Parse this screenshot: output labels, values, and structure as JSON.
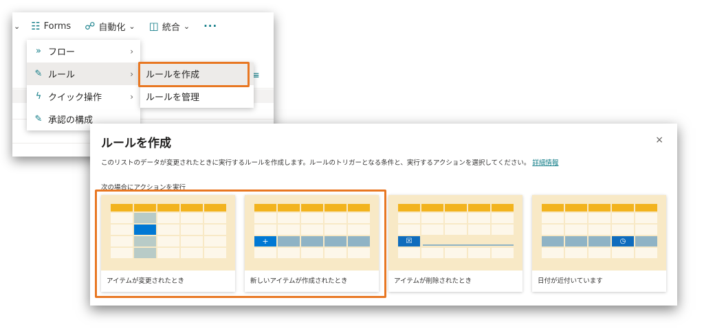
{
  "command_bar": {
    "forms_label": "Forms",
    "automate_label": "自動化",
    "integrate_label": "統合",
    "more_label": "···"
  },
  "automate_menu": {
    "items": [
      {
        "label": "フロー",
        "icon": "flow-icon",
        "has_submenu": true
      },
      {
        "label": "ルール",
        "icon": "rule-icon",
        "has_submenu": true
      },
      {
        "label": "クイック操作",
        "icon": "quick-action-icon",
        "has_submenu": true
      },
      {
        "label": "承認の構成",
        "icon": "approval-icon",
        "has_submenu": false
      }
    ]
  },
  "rules_submenu": {
    "items": [
      {
        "label": "ルールを作成"
      },
      {
        "label": "ルールを管理"
      }
    ]
  },
  "dialog": {
    "title": "ルールを作成",
    "close_label": "×",
    "description": "このリストのデータが変更されたときに実行するルールを作成します。ルールのトリガーとなる条件と、実行するアクションを選択してください。",
    "learn_more": "詳細情報",
    "section_label": "次の場合にアクションを実行",
    "cards": [
      {
        "label": "アイテムが変更されたとき"
      },
      {
        "label": "新しいアイテムが作成されたとき"
      },
      {
        "label": "アイテムが削除されたとき"
      },
      {
        "label": "日付が近付いています"
      }
    ]
  },
  "colors": {
    "accent": "#0f7b86",
    "highlight": "#e87722",
    "card_bg": "#f8e9c6",
    "grid_header": "#f2b31e"
  }
}
